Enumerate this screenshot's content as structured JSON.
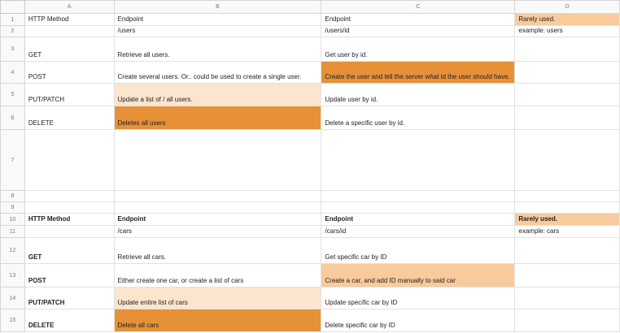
{
  "columns": [
    "A",
    "B",
    "C",
    "D"
  ],
  "row_numbers": [
    "1",
    "2",
    "3",
    "4",
    "5",
    "6",
    "7",
    "8",
    "9",
    "10",
    "11",
    "12",
    "13",
    "14",
    "15"
  ],
  "rows": [
    [
      "HTTP Method",
      "Endpoint",
      "Endpoint",
      "Rarely used."
    ],
    [
      "",
      "/users",
      "/users/id",
      "example: users"
    ],
    [
      "GET",
      "Retrieve all users.",
      "Get user by id.",
      ""
    ],
    [
      "POST",
      "Create several users.  Or.. could be used to create a single user.",
      "Create the user and tell the server what id the user should have.",
      ""
    ],
    [
      "PUT/PATCH",
      "Update a list of / all users.",
      "Update user by id.",
      ""
    ],
    [
      "DELETE",
      "Deletes all users",
      "Delete a specific user by id.",
      ""
    ],
    [
      "",
      "",
      "",
      ""
    ],
    [
      "",
      "",
      "",
      ""
    ],
    [
      "",
      "",
      "",
      ""
    ],
    [
      "HTTP Method",
      "Endpoint",
      "Endpoint",
      "Rarely used."
    ],
    [
      "",
      "/cars",
      "/cars/id",
      "example: cars"
    ],
    [
      "GET",
      "Retrieve all cars.",
      "Get specific car by ID",
      ""
    ],
    [
      "POST",
      "Either create one car, or create a list of cars",
      "Create a car, and add ID manually to said car",
      ""
    ],
    [
      "PUT/PATCH",
      "Update entire list of cars",
      "Update specific car by ID",
      ""
    ],
    [
      "DELETE",
      "Delete all cars",
      "Delete specific car by ID",
      ""
    ]
  ],
  "colors": {
    "light_orange": "#fce5cd",
    "medium_orange": "#f9cb9c",
    "dark_orange": "#e69138",
    "header_bg": "#f8f9fa",
    "gridline": "#e2e2e2"
  }
}
